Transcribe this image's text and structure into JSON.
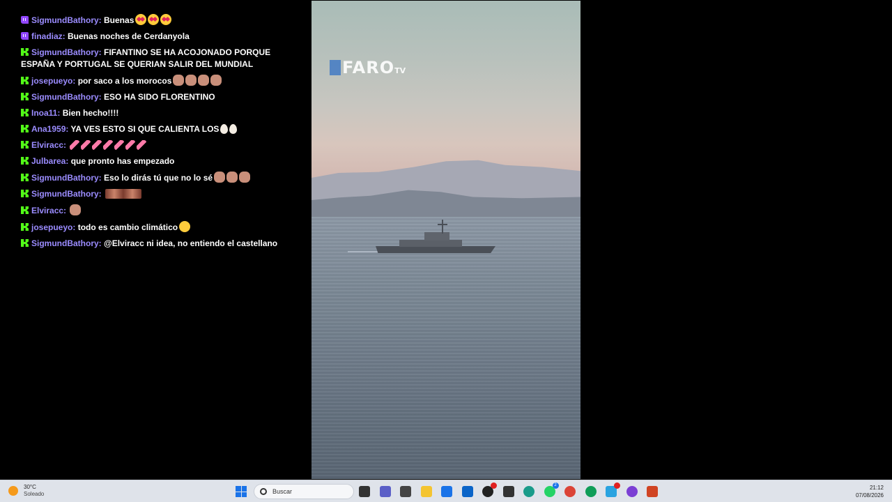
{
  "chat": {
    "messages": [
      {
        "platform": "twitch",
        "user": "SigmundBathory",
        "text": "Buenas",
        "emotes": [
          "heart-eyes",
          "heart-eyes",
          "heart-eyes"
        ]
      },
      {
        "platform": "twitch",
        "user": "finadiaz",
        "text": "Buenas noches de Cerdanyola",
        "emotes": []
      },
      {
        "platform": "kick",
        "user": "SigmundBathory",
        "text": "FIFANTINO SE HA ACOJONADO PORQUE ESPAÑA Y PORTUGAL SE QUERIAN SALIR DEL MUNDIAL",
        "emotes": []
      },
      {
        "platform": "kick",
        "user": "josepueyo",
        "text": "por saco a los morocos",
        "emotes": [
          "face",
          "face",
          "face",
          "face"
        ]
      },
      {
        "platform": "kick",
        "user": "SigmundBathory",
        "text": "ESO HA SIDO FLORENTINO",
        "emotes": []
      },
      {
        "platform": "kick",
        "user": "Inoa11",
        "text": "Bien hecho!!!!",
        "emotes": []
      },
      {
        "platform": "kick",
        "user": "Ana1959",
        "text": "YA VES ESTO SI QUE CALIENTA LOS",
        "emotes": [
          "egg",
          "egg"
        ]
      },
      {
        "platform": "kick",
        "user": "Elviracc",
        "text": "",
        "emotes": [
          "leg",
          "leg",
          "leg",
          "leg",
          "leg",
          "leg",
          "leg"
        ]
      },
      {
        "platform": "kick",
        "user": "Julbarea",
        "text": "que pronto has empezado",
        "emotes": []
      },
      {
        "platform": "kick",
        "user": "SigmundBathory",
        "text": "Eso lo dirás tú que no lo sé",
        "emotes": [
          "face",
          "face",
          "face"
        ]
      },
      {
        "platform": "kick",
        "user": "SigmundBathory",
        "text": "",
        "emotes": [
          "eyes"
        ]
      },
      {
        "platform": "kick",
        "user": "Elviracc",
        "text": "",
        "emotes": [
          "face"
        ]
      },
      {
        "platform": "kick",
        "user": "josepueyo",
        "text": "todo es cambio climático",
        "emotes": [
          "laugh"
        ]
      },
      {
        "platform": "kick",
        "user": "SigmundBathory",
        "text": "@Elviracc ni idea, no entiendo el castellano",
        "emotes": []
      }
    ]
  },
  "video": {
    "logo_text": "FARO",
    "logo_suffix": "TV"
  },
  "taskbar": {
    "weather_temp": "30°C",
    "weather_cond": "Soleado",
    "search_placeholder": "Buscar",
    "time": "21:12",
    "date": "07/08/2026",
    "icons": [
      {
        "name": "task-view-icon",
        "color": "#333333"
      },
      {
        "name": "teams-icon",
        "color": "#5b5fc7"
      },
      {
        "name": "app-icon",
        "color": "#444444"
      },
      {
        "name": "file-explorer-icon",
        "color": "#f4c430"
      },
      {
        "name": "store-icon",
        "color": "#1a73e8"
      },
      {
        "name": "outlook-icon",
        "color": "#0a64c8"
      },
      {
        "name": "obs-icon",
        "color": "#222222",
        "badge_red": true
      },
      {
        "name": "cube-app-icon",
        "color": "#333333"
      },
      {
        "name": "edge-icon",
        "color": "#1a9b8a"
      },
      {
        "name": "whatsapp-icon",
        "color": "#25d366",
        "badge": "2"
      },
      {
        "name": "chrome-icon",
        "color": "#db4437"
      },
      {
        "name": "chrome-alt-icon",
        "color": "#0f9d58"
      },
      {
        "name": "telegram-icon",
        "color": "#2aa3e0",
        "badge_red": true
      },
      {
        "name": "circle-app-icon",
        "color": "#7b3fd4"
      },
      {
        "name": "powerpoint-icon",
        "color": "#d04423"
      }
    ]
  }
}
